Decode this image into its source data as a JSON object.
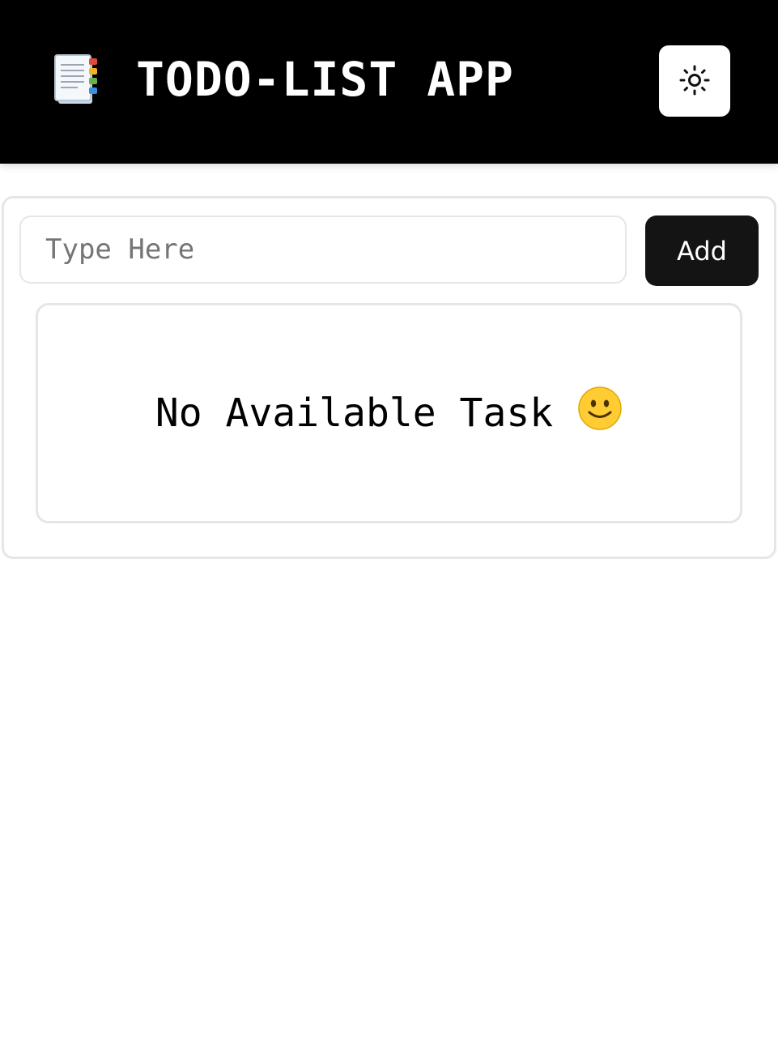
{
  "header": {
    "title": "TODO-LIST APP",
    "logo_icon": "notebook-icon",
    "theme_toggle_icon": "sun-icon"
  },
  "task_input": {
    "placeholder": "Type Here",
    "value": ""
  },
  "add_button": {
    "label": "Add"
  },
  "empty_state": {
    "message": "No Available Task",
    "icon": "smiley-face-icon"
  },
  "colors": {
    "header_bg": "#000000",
    "header_text": "#ffffff",
    "button_bg": "#141414",
    "border": "#e6e6e6",
    "smiley": "#ffcc33"
  }
}
